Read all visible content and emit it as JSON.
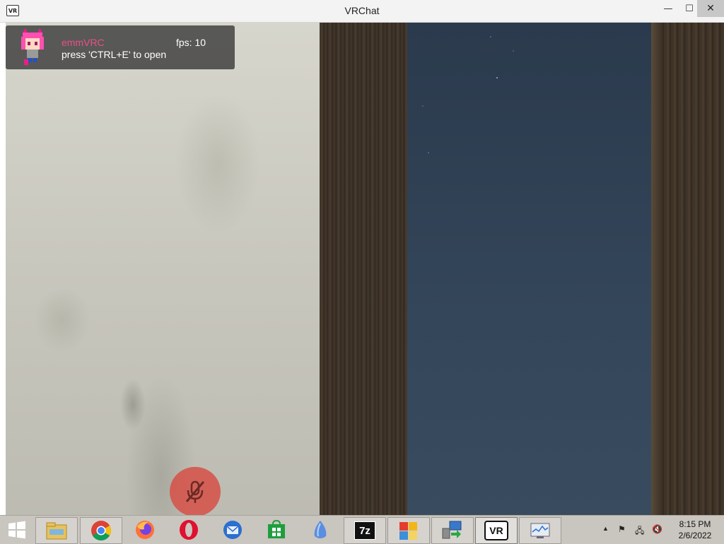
{
  "window": {
    "title": "VRChat",
    "app_icon_text": "VR",
    "minimize_glyph": "—",
    "maximize_glyph": "☐",
    "close_glyph": "✕"
  },
  "overlay": {
    "username": "emmVRC",
    "fps": "fps: 10",
    "hint": "press 'CTRL+E' to open"
  },
  "taskbar": {
    "start_icon": "windows-logo-icon",
    "pinned": [
      {
        "name": "file-explorer-icon",
        "running": true
      },
      {
        "name": "chrome-icon",
        "running": true
      },
      {
        "name": "firefox-icon",
        "running": false
      },
      {
        "name": "opera-icon",
        "running": false
      },
      {
        "name": "thunderbird-icon",
        "running": false
      },
      {
        "name": "store-icon",
        "running": false
      },
      {
        "name": "vr-launcher-icon",
        "running": false
      },
      {
        "name": "7zip-icon",
        "running": true
      },
      {
        "name": "control-panel-icon",
        "running": true
      },
      {
        "name": "network-tool-icon",
        "running": true
      },
      {
        "name": "vrchat-taskbar-icon",
        "running": true,
        "active": true
      },
      {
        "name": "performance-monitor-icon",
        "running": true
      }
    ],
    "seven_zip_label": "7z",
    "vrchat_label": "VR",
    "clock": {
      "time": "8:15 PM",
      "date": "2/6/2022"
    }
  },
  "colors": {
    "username": "#ea4f8a",
    "mic_button": "#d65046"
  }
}
